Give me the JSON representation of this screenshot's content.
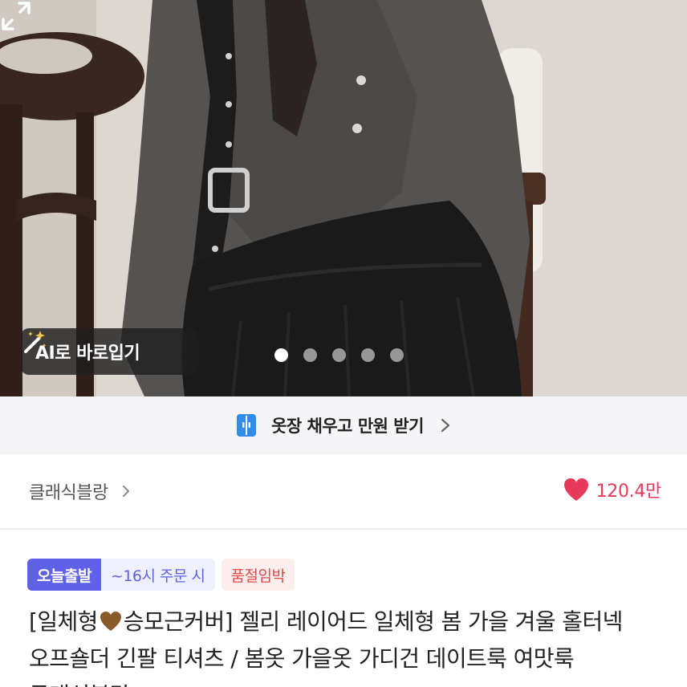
{
  "hero": {
    "ai_button_label": "AI로 바로입기",
    "ai_icon": "magic-wand-icon",
    "expand_icon": "expand-icon",
    "carousel": {
      "total": 5,
      "active_index": 0
    }
  },
  "closet_banner": {
    "icon": "closet-icon",
    "text": "옷장 채우고 만원 받기",
    "accent": "#2f8ce8"
  },
  "brand": {
    "name": "클래식블랑",
    "likes": "120.4만",
    "likes_color": "#e8395a"
  },
  "badges": {
    "today": "오늘출발",
    "cutoff": "~16시 주문 시",
    "stock": "품절임박",
    "today_color": "#5f62e6",
    "stock_color": "#e24a4a"
  },
  "title": {
    "part1": "[일체형",
    "part2": "승모근커버] 젤리 레이어드 일체형 봄 가을 겨울 홀터넥 오프숄더 긴팔 티셔츠 / 봄옷 가을옷 가디건 데이트룩 여맛룩 클래식블랑",
    "heart_icon": "brown-heart-icon"
  }
}
